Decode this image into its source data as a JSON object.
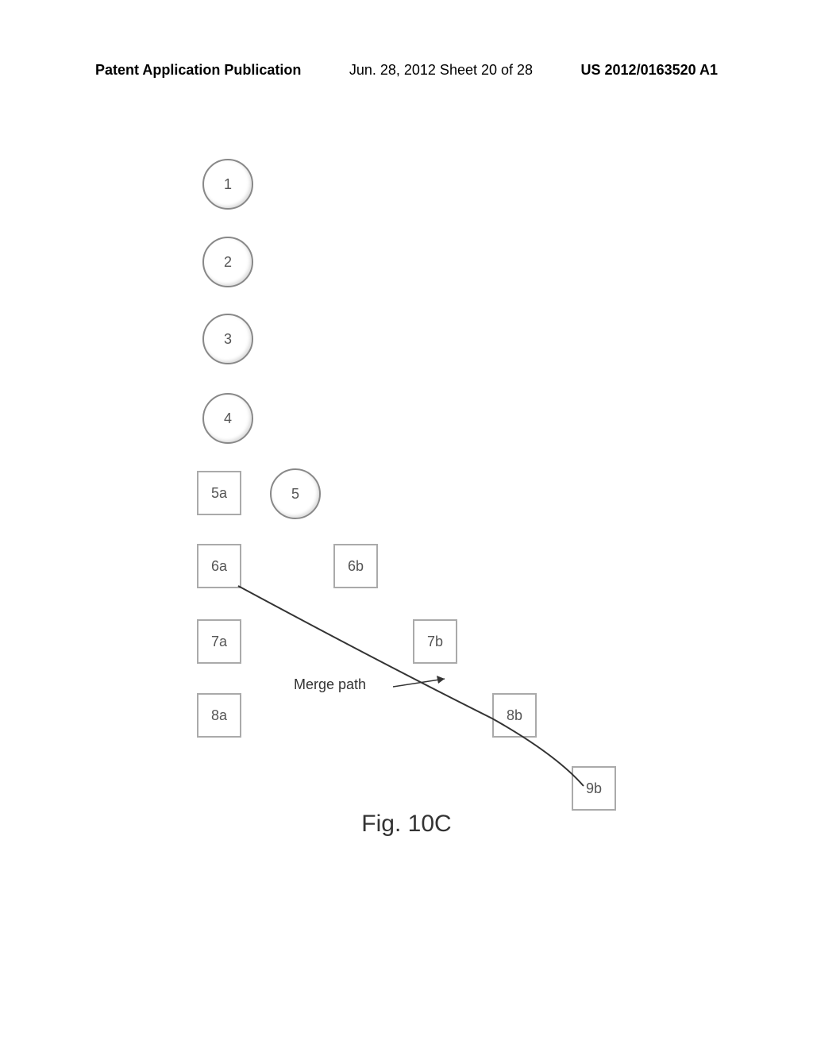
{
  "header": {
    "left": "Patent Application Publication",
    "center": "Jun. 28, 2012  Sheet 20 of 28",
    "right": "US 2012/0163520 A1"
  },
  "nodes": {
    "circle1": "1",
    "circle2": "2",
    "circle3": "3",
    "circle4": "4",
    "circle5": "5",
    "square5a": "5a",
    "square6a": "6a",
    "square7a": "7a",
    "square8a": "8a",
    "square6b": "6b",
    "square7b": "7b",
    "square8b": "8b",
    "square9b": "9b"
  },
  "labels": {
    "merge_path": "Merge path"
  },
  "figure_caption": "Fig. 10C"
}
